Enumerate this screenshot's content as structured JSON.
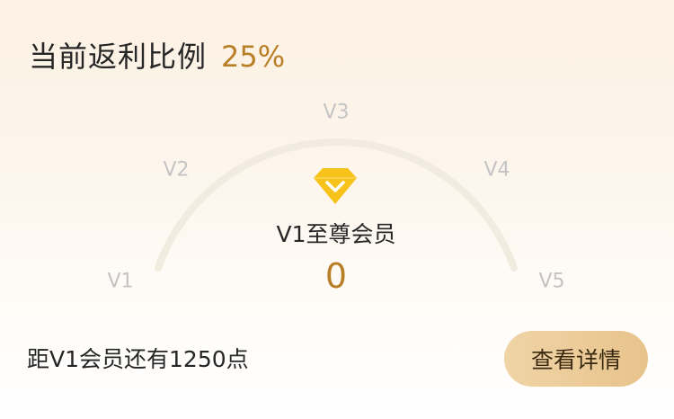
{
  "header": {
    "label": "当前返利比例",
    "value": "25%"
  },
  "gauge": {
    "levels": [
      "V1",
      "V2",
      "V3",
      "V4",
      "V5"
    ],
    "progress_fraction": 0,
    "track_color": "#f2ece0"
  },
  "member": {
    "icon": "diamond-icon",
    "level_name": "V1至尊会员",
    "points": "0"
  },
  "footer": {
    "progress_text": "距V1会员还有1250点",
    "details_label": "查看详情"
  },
  "colors": {
    "accent": "#b87f26",
    "badge": "#f7c21a",
    "button": "#ecc995"
  }
}
